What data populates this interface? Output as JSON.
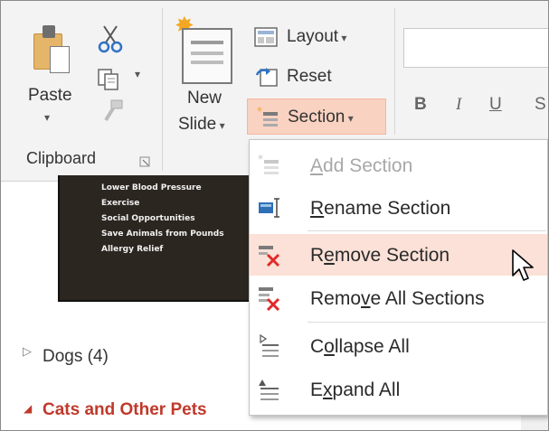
{
  "ribbon": {
    "clipboard": {
      "paste_label": "Paste",
      "group_label": "Clipboard",
      "icons": [
        "paste-icon",
        "cut-icon",
        "copy-icon",
        "format-painter-icon",
        "dialog-launcher-icon"
      ]
    },
    "slides": {
      "new_slide_label_line1": "New",
      "new_slide_label_line2": "Slide",
      "layout_label": "Layout",
      "reset_label": "Reset",
      "section_label": "Section"
    },
    "font": {
      "bold_label": "B",
      "italic_label": "I",
      "underline_label": "U",
      "strike_label": "S"
    }
  },
  "slide_thumbnail": {
    "items": [
      "Lower Blood Pressure",
      "Exercise",
      "Social Opportunities",
      "Save Animals from Pounds",
      "Allergy Relief"
    ]
  },
  "sections_panel": {
    "collapsed_section": "Dogs (4)",
    "expanded_section": "Cats and Other Pets"
  },
  "section_menu": {
    "items": [
      {
        "label": "Add Section",
        "icon": "add-section-icon",
        "enabled": false,
        "accel": "A"
      },
      {
        "label": "Rename Section",
        "icon": "rename-section-icon",
        "enabled": true,
        "accel": "R"
      },
      {
        "label": "Remove Section",
        "icon": "remove-section-icon",
        "enabled": true,
        "hover": true,
        "accel": "e"
      },
      {
        "label": "Remove All Sections",
        "icon": "remove-all-sections-icon",
        "enabled": true,
        "accel": "v"
      },
      {
        "label": "Collapse All",
        "icon": "collapse-all-icon",
        "enabled": true,
        "accel": "o"
      },
      {
        "label": "Expand All",
        "icon": "expand-all-icon",
        "enabled": true,
        "accel": "x"
      }
    ]
  },
  "colors": {
    "accent_highlight": "#f9d2c1",
    "hover_item": "#fbe1d7",
    "delete_red": "#e02b2b",
    "section_title_red": "#c0392b",
    "thumbnail_bg": "#2c2620"
  }
}
